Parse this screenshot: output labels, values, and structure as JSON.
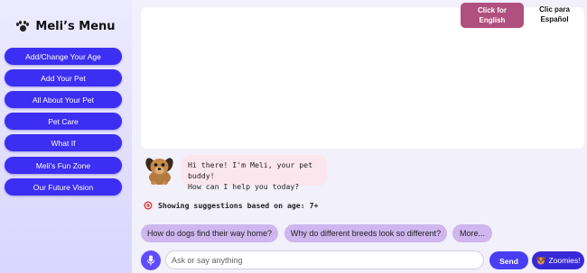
{
  "sidebar": {
    "title": "Meli’s Menu",
    "items": [
      {
        "label": "Add/Change Your Age"
      },
      {
        "label": "Add Your Pet"
      },
      {
        "label": "All About Your Pet"
      },
      {
        "label": "Pet Care"
      },
      {
        "label": "What If"
      },
      {
        "label": "Meli's Fun Zone"
      },
      {
        "label": "Our Future Vision"
      }
    ]
  },
  "language": {
    "english_line1": "Click for",
    "english_line2": "English",
    "spanish_line1": "Clic para",
    "spanish_line2": "Español"
  },
  "chat": {
    "greeting_line1": "Hi there! I'm Meli, your pet buddy!",
    "greeting_line2": "How can I help you today?",
    "suggestion_note": "Showing suggestions based on age: 7+",
    "suggestions": [
      {
        "label": "How do dogs find their way home?"
      },
      {
        "label": "Why do different breeds look so different?"
      },
      {
        "label": "More..."
      }
    ]
  },
  "input": {
    "placeholder": "Ask or say anything",
    "send_label": "Send",
    "zoomies_label": "Zoomies!"
  },
  "colors": {
    "menu_button": "#3c2ef2",
    "english_button": "#b0507e",
    "chat_bubble": "#fbe6ee",
    "suggestion_chip": "#cfb6ef"
  }
}
